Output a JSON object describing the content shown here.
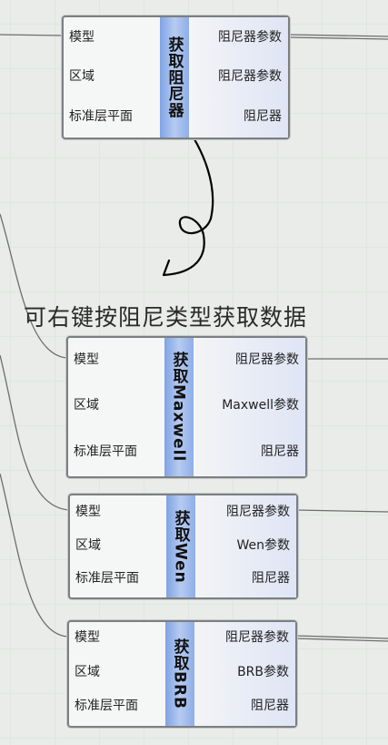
{
  "nodes": [
    {
      "title": "获取阻尼器",
      "inputs": [
        "模型",
        "区域",
        "标准层平面"
      ],
      "outputs": [
        "阻尼器参数",
        "阻尼器参数",
        "阻尼器"
      ]
    },
    {
      "title": "获取Maxwell",
      "inputs": [
        "模型",
        "区域",
        "标准层平面"
      ],
      "outputs": [
        "阻尼器参数",
        "Maxwell参数",
        "阻尼器"
      ]
    },
    {
      "title": "获取Wen",
      "inputs": [
        "模型",
        "区域",
        "标准层平面"
      ],
      "outputs": [
        "阻尼器参数",
        "Wen参数",
        "阻尼器"
      ]
    },
    {
      "title": "获取BRB",
      "inputs": [
        "模型",
        "区域",
        "标准层平面"
      ],
      "outputs": [
        "阻尼器参数",
        "BRB参数",
        "阻尼器"
      ]
    }
  ],
  "annotation": {
    "text": "可右键按阻尼类型获取数据"
  },
  "colors": {
    "canvas": "#e9ece9",
    "title_strip": "#8eaee8",
    "wire": "#6e6e6e",
    "ink": "#000000"
  }
}
